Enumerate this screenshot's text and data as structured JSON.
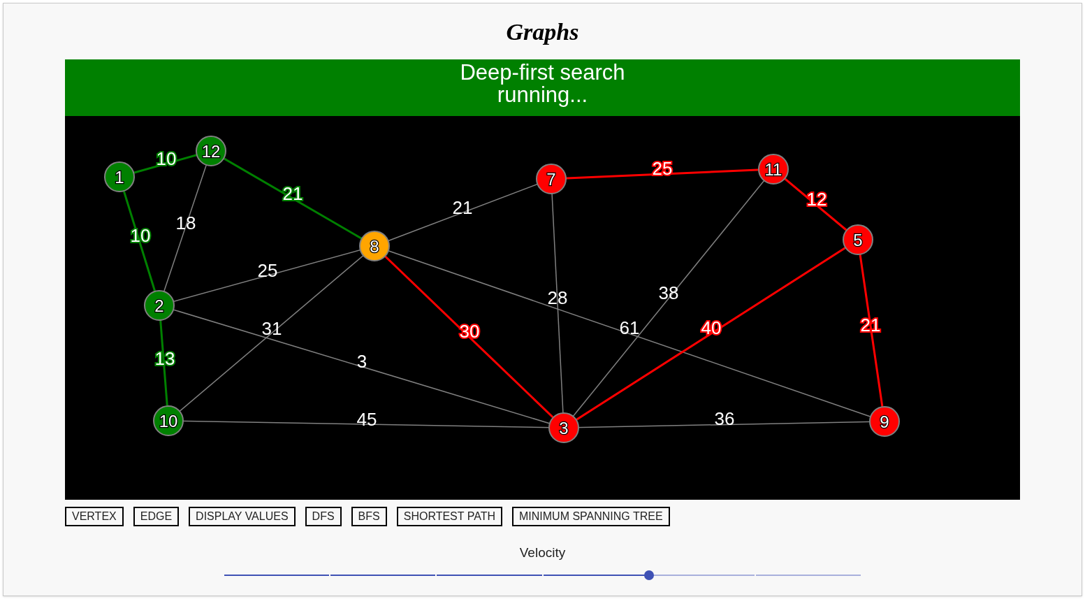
{
  "title": "Graphs",
  "status": {
    "text": "Deep-first search running..."
  },
  "graph": {
    "nodes": [
      {
        "label": "1",
        "color": "#008000"
      },
      {
        "label": "12",
        "color": "#008000"
      },
      {
        "label": "8",
        "color": "#ffa500"
      },
      {
        "label": "7",
        "color": "#ff0000"
      },
      {
        "label": "11",
        "color": "#ff0000"
      },
      {
        "label": "5",
        "color": "#ff0000"
      },
      {
        "label": "2",
        "color": "#008000"
      },
      {
        "label": "10",
        "color": "#008000"
      },
      {
        "label": "3",
        "color": "#ff0000"
      },
      {
        "label": "9",
        "color": "#ff0000"
      }
    ],
    "edges": [
      {
        "weight": "10",
        "color": "#008000",
        "highlighted": true
      },
      {
        "weight": "10",
        "color": "#008000",
        "highlighted": true
      },
      {
        "weight": "21",
        "color": "#008000",
        "highlighted": true
      },
      {
        "weight": "18",
        "color": "#808080",
        "highlighted": false
      },
      {
        "weight": "25",
        "color": "#808080",
        "highlighted": false
      },
      {
        "weight": "3",
        "color": "#808080",
        "highlighted": false
      },
      {
        "weight": "13",
        "color": "#008000",
        "highlighted": true
      },
      {
        "weight": "31",
        "color": "#808080",
        "highlighted": false
      },
      {
        "weight": "45",
        "color": "#808080",
        "highlighted": false
      },
      {
        "weight": "21",
        "color": "#808080",
        "highlighted": false
      },
      {
        "weight": "30",
        "color": "#ff0000",
        "highlighted": true
      },
      {
        "weight": "61",
        "color": "#808080",
        "highlighted": false
      },
      {
        "weight": "28",
        "color": "#808080",
        "highlighted": false
      },
      {
        "weight": "25",
        "color": "#ff0000",
        "highlighted": true
      },
      {
        "weight": "12",
        "color": "#ff0000",
        "highlighted": true
      },
      {
        "weight": "38",
        "color": "#808080",
        "highlighted": false
      },
      {
        "weight": "40",
        "color": "#ff0000",
        "highlighted": true
      },
      {
        "weight": "21",
        "color": "#ff0000",
        "highlighted": true
      },
      {
        "weight": "36",
        "color": "#808080",
        "highlighted": false
      }
    ]
  },
  "buttons": [
    "VERTEX",
    "EDGE",
    "DISPLAY VALUES",
    "DFS",
    "BFS",
    "SHORTEST PATH",
    "MINIMUM SPANNING TREE"
  ],
  "velocity": {
    "label": "Velocity",
    "level": 0.667
  }
}
